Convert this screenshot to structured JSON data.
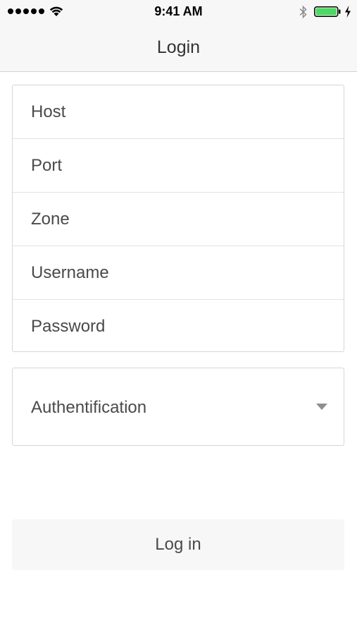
{
  "status_bar": {
    "time": "9:41 AM",
    "signal_icon": "signal-dots-icon",
    "wifi_icon": "wifi-icon",
    "bluetooth_icon": "bluetooth-icon",
    "battery_icon": "battery-icon",
    "charging_icon": "charging-bolt-icon",
    "battery_level": 1.0,
    "battery_color": "#4cd964"
  },
  "nav": {
    "title": "Login"
  },
  "form": {
    "fields": [
      {
        "placeholder": "Host",
        "value": ""
      },
      {
        "placeholder": "Port",
        "value": ""
      },
      {
        "placeholder": "Zone",
        "value": ""
      },
      {
        "placeholder": "Username",
        "value": ""
      },
      {
        "placeholder": "Password",
        "value": ""
      }
    ],
    "authentication": {
      "label": "Authentification",
      "icon": "chevron-down-icon"
    },
    "login_label": "Log in"
  },
  "colors": {
    "header_bg": "#f7f7f7",
    "border": "#d6d6d6",
    "text": "#4a4a4a",
    "button_bg": "#f7f7f7"
  }
}
